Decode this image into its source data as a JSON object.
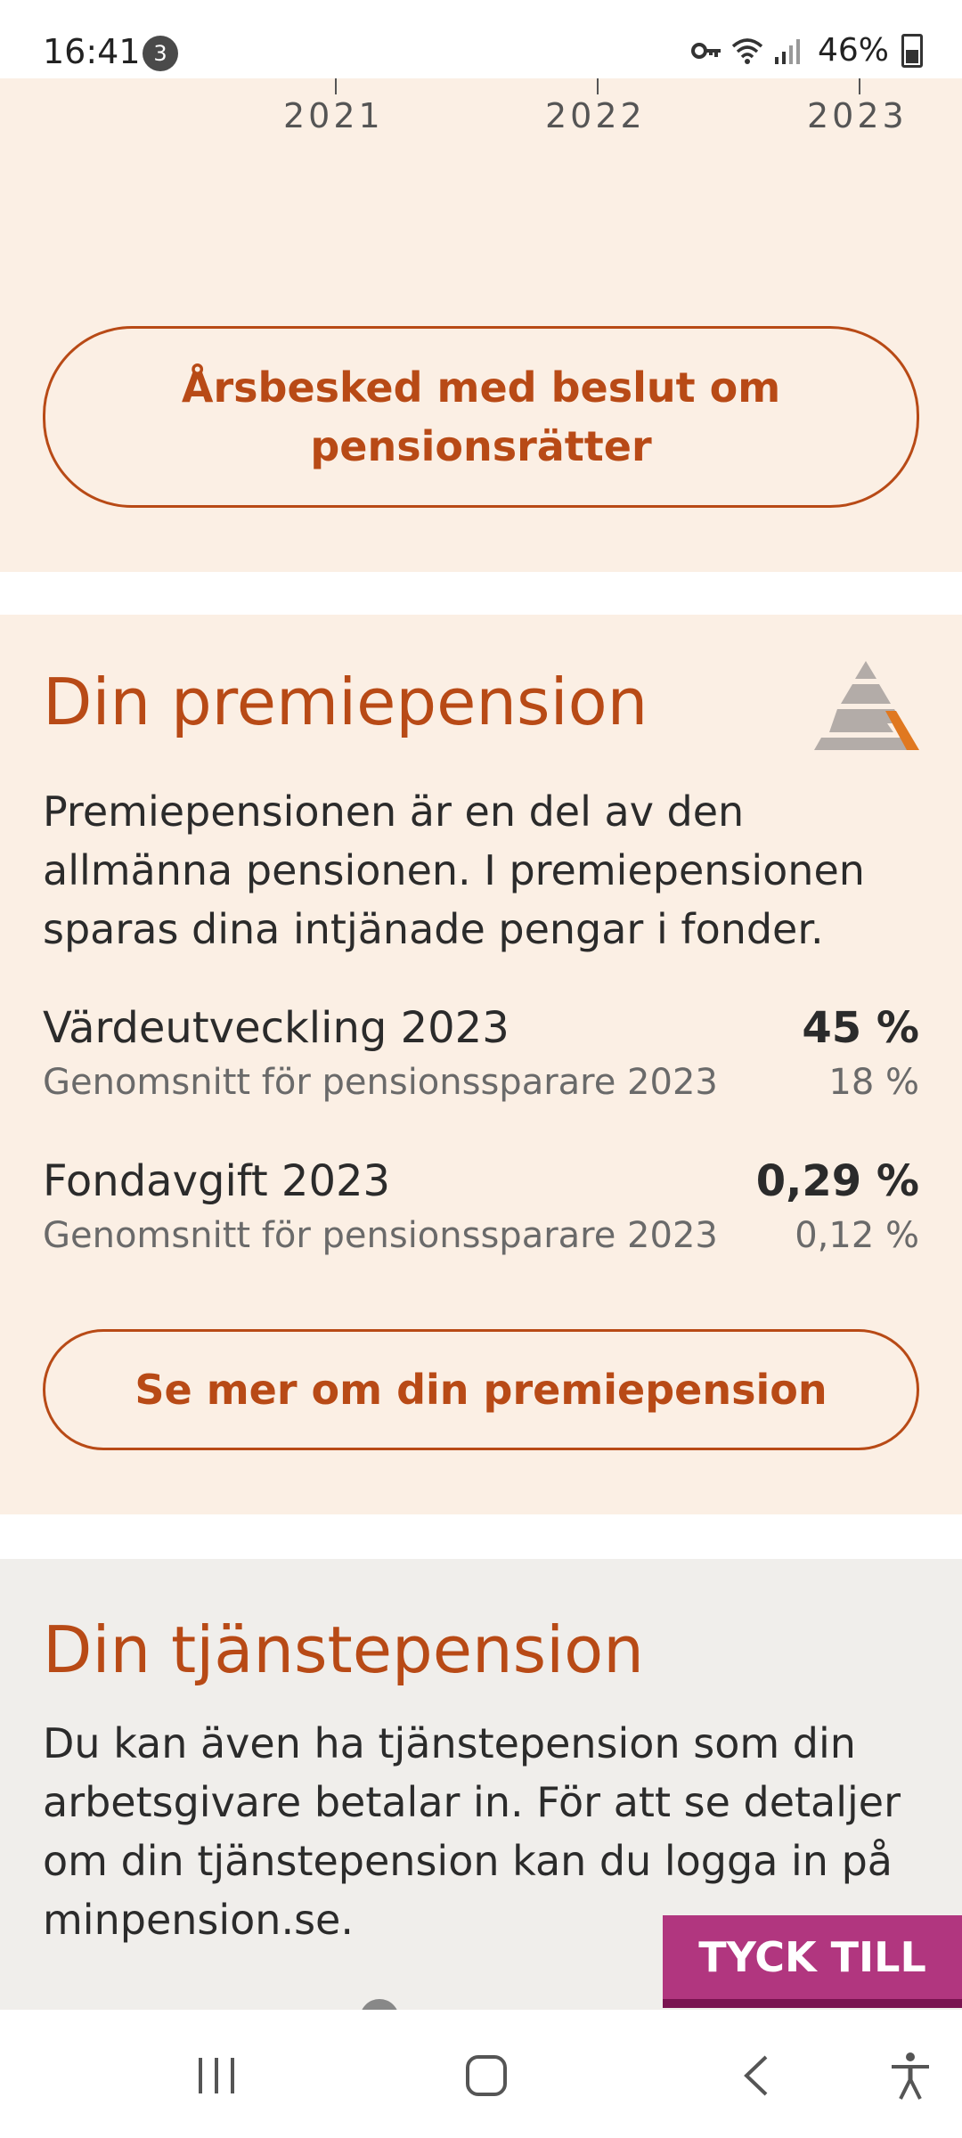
{
  "status_bar": {
    "time": "16:41",
    "notification_count": "3",
    "battery": "46%"
  },
  "chart": {
    "year_labels": [
      "2021",
      "2022",
      "2023"
    ]
  },
  "annual_statement_button": {
    "label": "Årsbesked med beslut om pensionsrätter"
  },
  "premiepension": {
    "title": "Din premiepension",
    "description": "Premiepensionen är en del av den allmänna pensionen. I premiepensionen sparas dina intjänade pengar i fonder.",
    "value_growth": {
      "label": "Värdeutveckling 2023",
      "value": "45 %",
      "avg_label": "Genomsnitt för pensionssparare 2023",
      "avg_value": "18 %"
    },
    "fund_fee": {
      "label": "Fondavgift 2023",
      "value": "0,29 %",
      "avg_label": "Genomsnitt för pensionssparare 2023",
      "avg_value": "0,12 %"
    },
    "more_button": "Se mer om din premiepension"
  },
  "tjanstepension": {
    "title": "Din tjänstepension",
    "description": "Du kan även ha tjänstepension som din arbetsgivare betalar in. För att se detaljer om din tjänstepension kan du logga in på minpension.se."
  },
  "feedback_tab": "TYCK TILL",
  "colors": {
    "accent": "#b84a16",
    "section_bg": "#fbefe4",
    "section_bg_gray": "#f0eeeb",
    "feedback": "#b1367f"
  }
}
